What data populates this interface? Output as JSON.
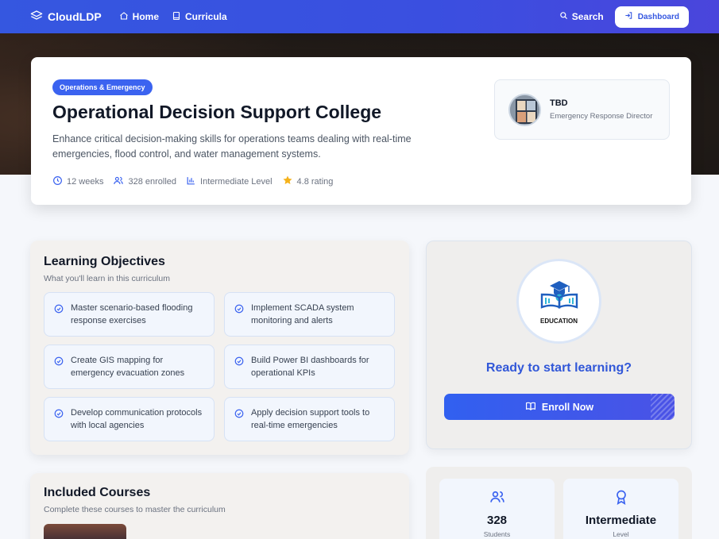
{
  "nav": {
    "brand": "CloudLDP",
    "home": "Home",
    "curricula": "Curricula",
    "search": "Search",
    "dashboard": "Dashboard"
  },
  "header": {
    "badge": "Operations & Emergency",
    "title": "Operational Decision Support College",
    "description": "Enhance critical decision-making skills for operations teams dealing with real-time emergencies, flood control, and water management systems.",
    "meta": {
      "duration": "12 weeks",
      "enrolled": "328 enrolled",
      "level": "Intermediate Level",
      "rating": "4.8 rating"
    },
    "instructor": {
      "name": "TBD",
      "role": "Emergency Response Director"
    }
  },
  "objectives": {
    "title": "Learning Objectives",
    "subtitle": "What you'll learn in this curriculum",
    "items": [
      "Master scenario-based flooding response exercises",
      "Implement SCADA system monitoring and alerts",
      "Create GIS mapping for emergency evacuation zones",
      "Build Power BI dashboards for operational KPIs",
      "Develop communication protocols with local agencies",
      "Apply decision support tools to real-time emergencies"
    ]
  },
  "enroll": {
    "logo_text": "EDUCATION",
    "ready": "Ready to start learning?",
    "button": "Enroll Now"
  },
  "courses": {
    "title": "Included Courses",
    "subtitle": "Complete these courses to master the curriculum"
  },
  "stats": {
    "students_value": "328",
    "students_label": "Students",
    "level_value": "Intermediate",
    "level_label": "Level"
  },
  "colors": {
    "primary": "#3557e0",
    "accent_text": "#3157d8",
    "star": "#f5b21b"
  }
}
